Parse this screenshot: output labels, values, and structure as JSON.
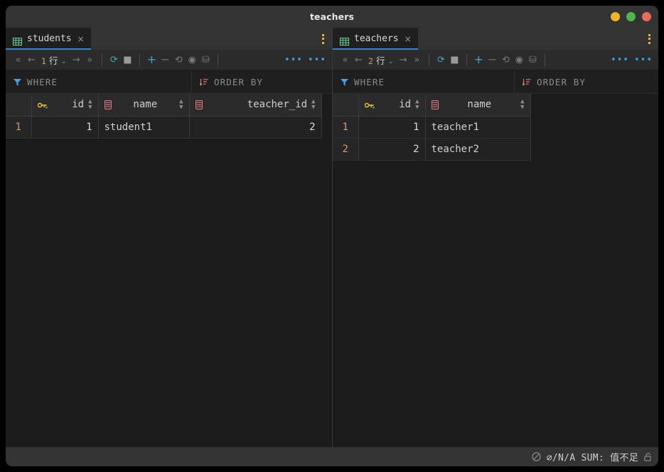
{
  "window": {
    "title": "teachers",
    "controls": [
      {
        "name": "minimize-button",
        "color": "#f0b429"
      },
      {
        "name": "maximize-button",
        "color": "#4cb84c"
      },
      {
        "name": "close-button",
        "color": "#ed6a5a"
      }
    ]
  },
  "panes": [
    {
      "id": "left",
      "tab": {
        "label": "students",
        "close": "×",
        "icon": "table-icon"
      },
      "kebab_icon": "more-options-icon",
      "toolbar": {
        "first_label": "«",
        "prev_label": "←",
        "row_count": "1",
        "row_unit": "行",
        "row_chevron": "⌄",
        "next_label": "→",
        "last_label": "»",
        "refresh_label": "⟳",
        "stop_label": "■",
        "add_label": "+",
        "remove_label": "−",
        "revert_label": "⟲",
        "view_label": "◉",
        "save_label": "⛁",
        "overflow_1": "•••",
        "overflow_2": "•••"
      },
      "filter": {
        "where_label": "WHERE",
        "where_icon": "filter-icon",
        "order_label": "ORDER BY",
        "order_icon": "sort-icon"
      },
      "table": {
        "columns": [
          {
            "name": "id",
            "icon": "primary-key-icon",
            "align": "right",
            "width": 94
          },
          {
            "name": "name",
            "icon": "column-icon",
            "align": "left",
            "width": 128
          },
          {
            "name": "teacher_id",
            "icon": "column-icon",
            "align": "right",
            "width": 186
          }
        ],
        "rows": [
          {
            "n": "1",
            "cells": [
              "1",
              "student1",
              "2"
            ]
          }
        ]
      }
    },
    {
      "id": "right",
      "tab": {
        "label": "teachers",
        "close": "×",
        "icon": "table-icon"
      },
      "kebab_icon": "more-options-icon",
      "toolbar": {
        "first_label": "«",
        "prev_label": "←",
        "row_count": "2",
        "row_unit": "行",
        "row_chevron": "⌄",
        "next_label": "→",
        "last_label": "»",
        "refresh_label": "⟳",
        "stop_label": "■",
        "add_label": "+",
        "remove_label": "−",
        "revert_label": "⟲",
        "view_label": "◉",
        "save_label": "⛁",
        "overflow_1": "•••",
        "overflow_2": "•••"
      },
      "filter": {
        "where_label": "WHERE",
        "where_icon": "filter-icon",
        "order_label": "ORDER BY",
        "order_icon": "sort-icon"
      },
      "table": {
        "columns": [
          {
            "name": "id",
            "icon": "primary-key-icon",
            "align": "right",
            "width": 94
          },
          {
            "name": "name",
            "icon": "column-icon",
            "align": "left",
            "width": 148
          }
        ],
        "rows": [
          {
            "n": "1",
            "cells": [
              "1",
              "teacher1"
            ]
          },
          {
            "n": "2",
            "cells": [
              "2",
              "teacher2"
            ]
          }
        ]
      }
    }
  ],
  "statusbar": {
    "no_value_icon": "no-value-circle-icon",
    "stats": "⌀/N/A  SUM: 值不足",
    "lock_icon": "unlocked-icon"
  },
  "colors": {
    "accent_blue": "#2f86d2",
    "accent_cyan": "#3fa5c4",
    "key_yellow": "#e0b82a",
    "column_red": "#e07a7a",
    "gutter_gold": "#c8a06a"
  }
}
